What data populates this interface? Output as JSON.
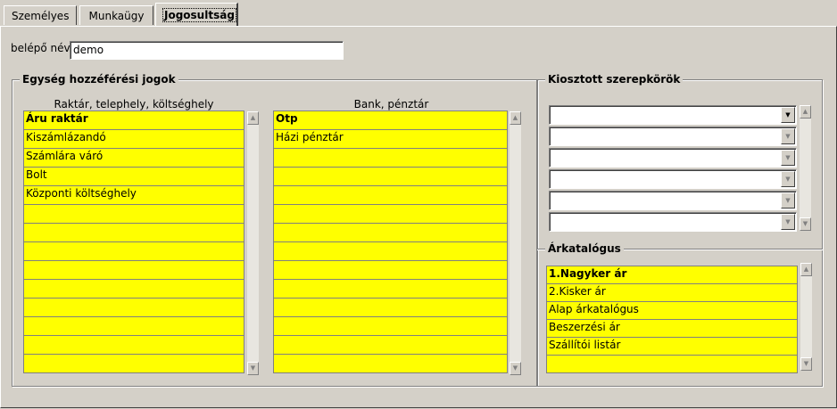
{
  "tabs": [
    {
      "label": "Személyes",
      "active": false
    },
    {
      "label": "Munkaügy",
      "active": false
    },
    {
      "label": "Jogosultság",
      "active": true
    }
  ],
  "login": {
    "label": "belépő név",
    "value": "demo"
  },
  "unit_access": {
    "title": "Egység hozzéférési jogok",
    "warehouse": {
      "header": "Raktár, telephely, költséghely",
      "items": [
        "Áru raktár",
        "Kiszámlázandó",
        "Számlára váró",
        "Bolt",
        "Központi költséghely"
      ]
    },
    "bank": {
      "header": "Bank, pénztár",
      "items": [
        "Otp",
        "Házi pénztár"
      ]
    }
  },
  "roles": {
    "title": "Kiosztott szerepkörök"
  },
  "price_catalog": {
    "title": "Árkatalógus",
    "items": [
      "1.Nagyker ár",
      "2.Kisker ár",
      "Alap árkatalógus",
      "Beszerzési ár",
      "Szállítói listár"
    ]
  },
  "icons": {
    "scroll_up": "triangle-up-icon",
    "scroll_down": "triangle-down-icon",
    "dropdown": "triangle-down-icon"
  },
  "colors": {
    "highlight": "#ffff00",
    "background": "#d4d0c8"
  }
}
